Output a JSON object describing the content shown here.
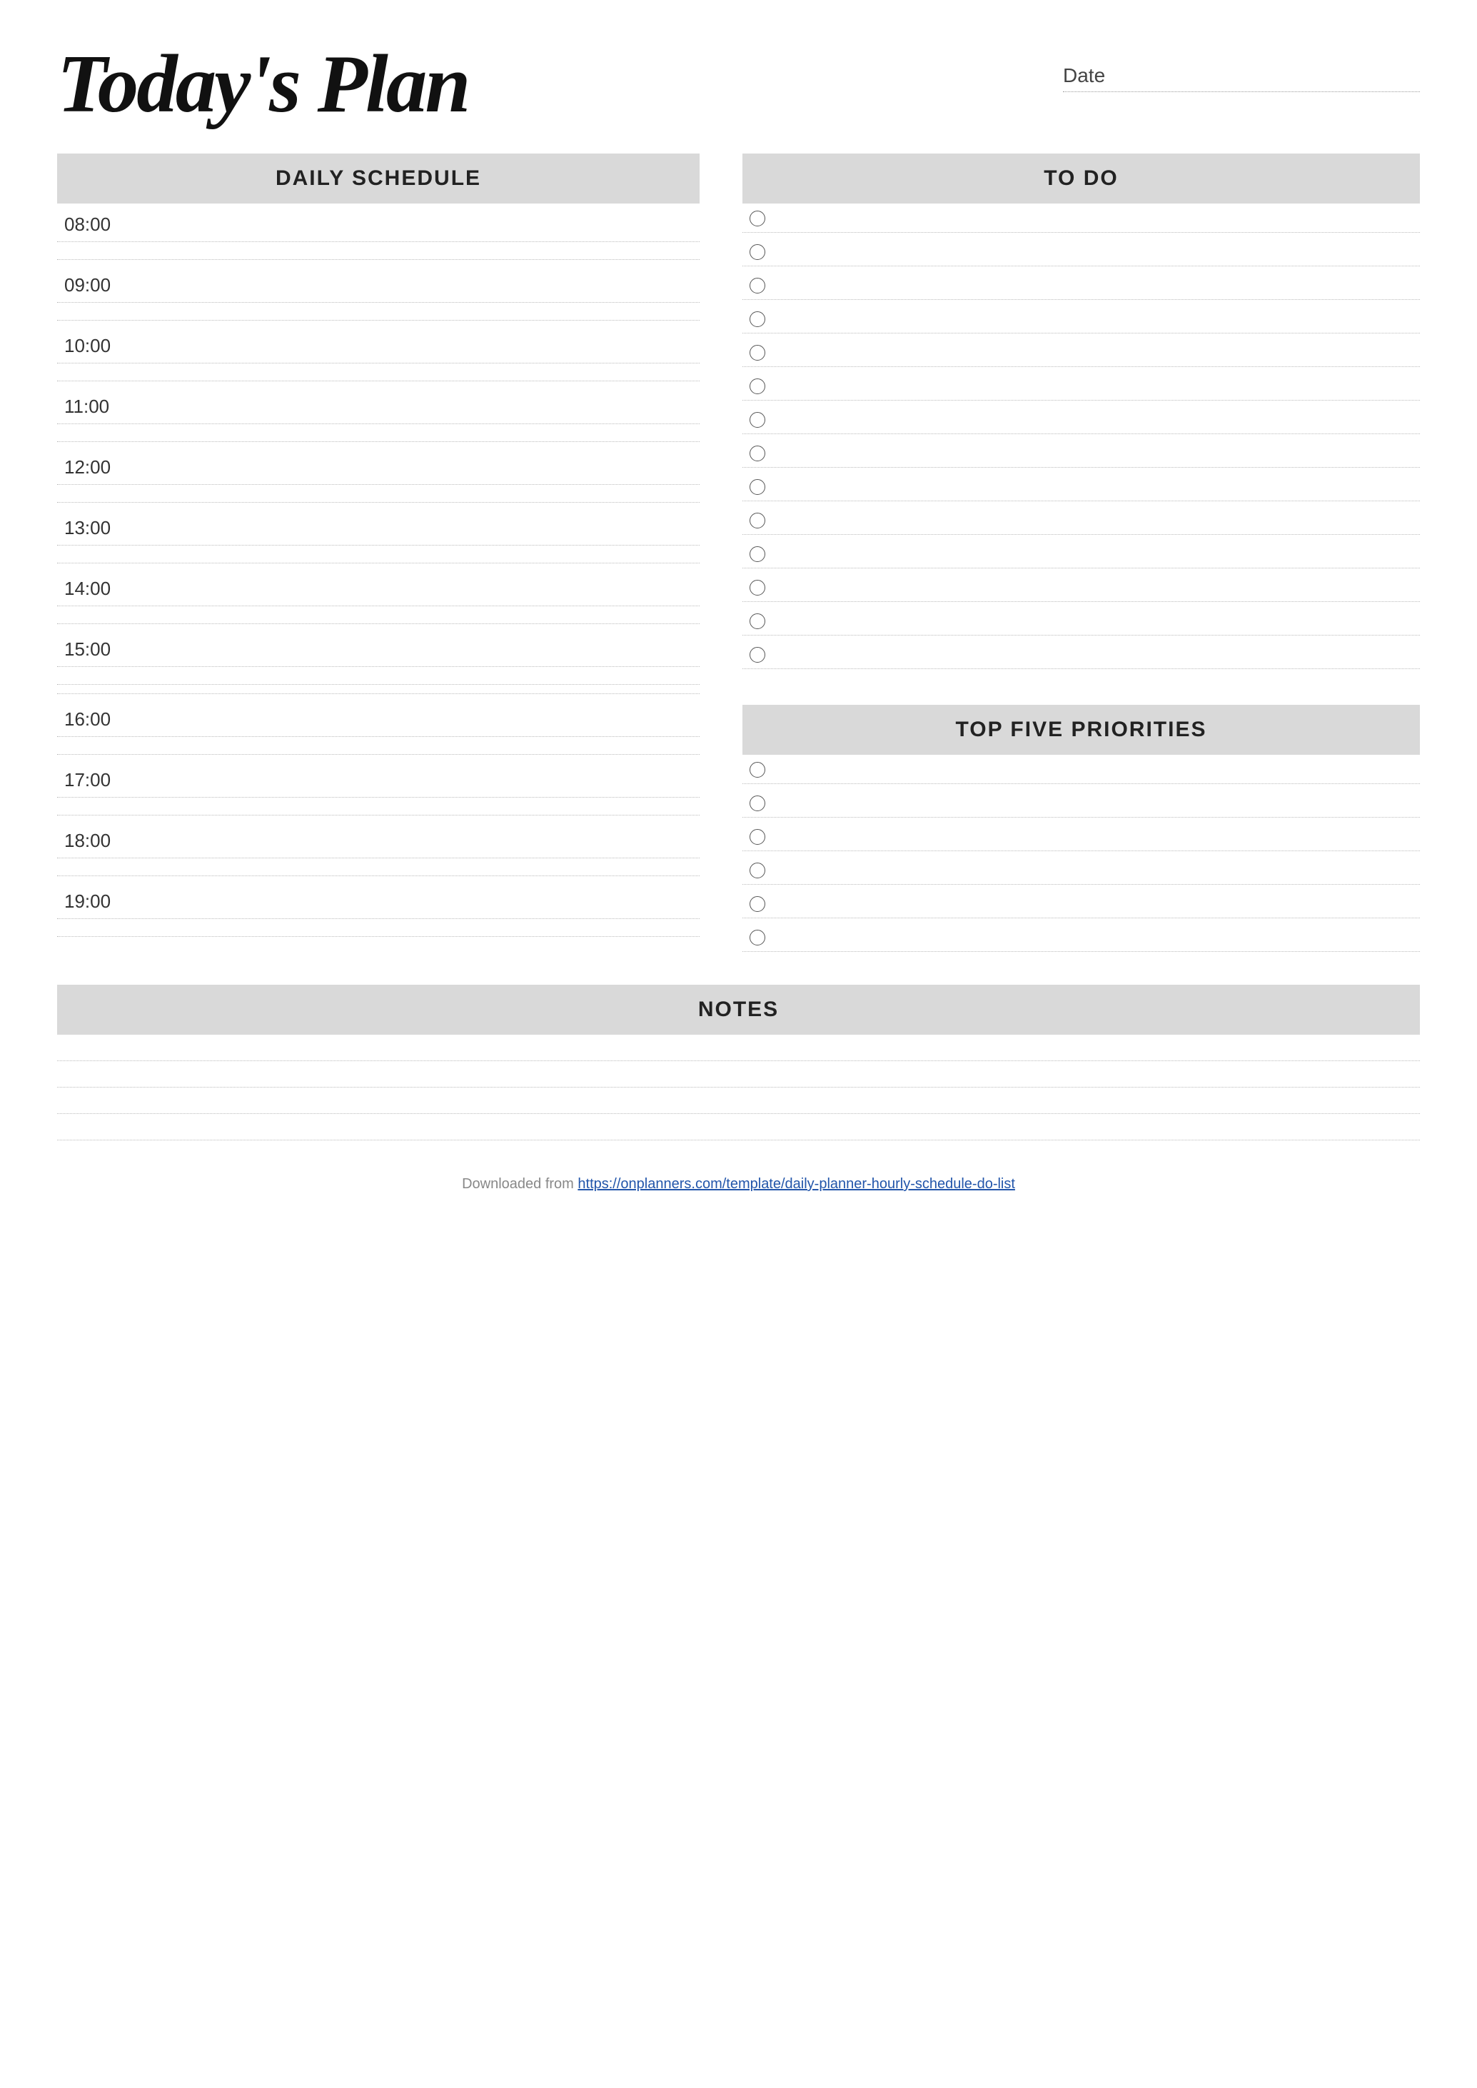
{
  "header": {
    "title": "Today's Plan",
    "date_label": "Date"
  },
  "daily_schedule": {
    "section_label": "DAILY SCHEDULE",
    "times": [
      "08:00",
      "09:00",
      "10:00",
      "11:00",
      "12:00",
      "13:00",
      "14:00",
      "15:00",
      "16:00",
      "17:00",
      "18:00",
      "19:00"
    ]
  },
  "todo": {
    "section_label": "TO DO",
    "items_count": 14
  },
  "priorities": {
    "section_label": "TOP FIVE PRIORITIES",
    "items_count": 6
  },
  "notes": {
    "section_label": "NOTES",
    "lines_count": 4
  },
  "footer": {
    "text": "Downloaded from ",
    "link_text": "https://onplanners.com/template/daily-planner-hourly-schedule-do-list",
    "link_href": "https://onplanners.com/template/daily-planner-hourly-schedule-do-list"
  }
}
